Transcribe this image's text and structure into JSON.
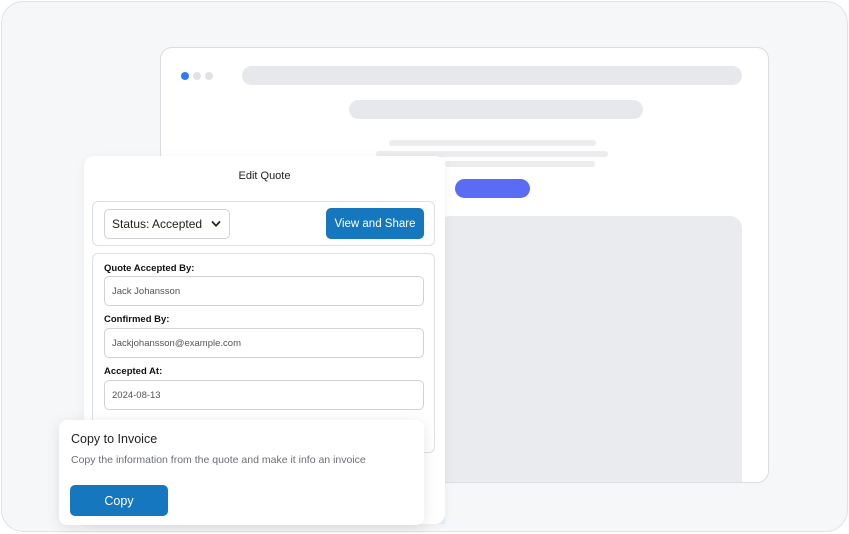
{
  "panel": {
    "title": "Edit Quote",
    "status_select": {
      "value": "Status: Accepted"
    },
    "view_share_label": "View and Share",
    "fields": [
      {
        "label": "Quote Accepted By:",
        "value": "Jack Johansson"
      },
      {
        "label": "Confirmed By:",
        "value": "Jackjohansson@example.com"
      },
      {
        "label": "Accepted At:",
        "value": "2024-08-13"
      }
    ]
  },
  "copy_card": {
    "title": "Copy to Invoice",
    "description": "Copy the information from the quote and make it info an invoice",
    "button_label": "Copy"
  },
  "colors": {
    "primary_button": "#1577bd",
    "browser_cta": "#5b6cf4",
    "browser_dot_active": "#2f7cf6"
  },
  "icons": {
    "status_chevron": "chevron-down-icon"
  }
}
